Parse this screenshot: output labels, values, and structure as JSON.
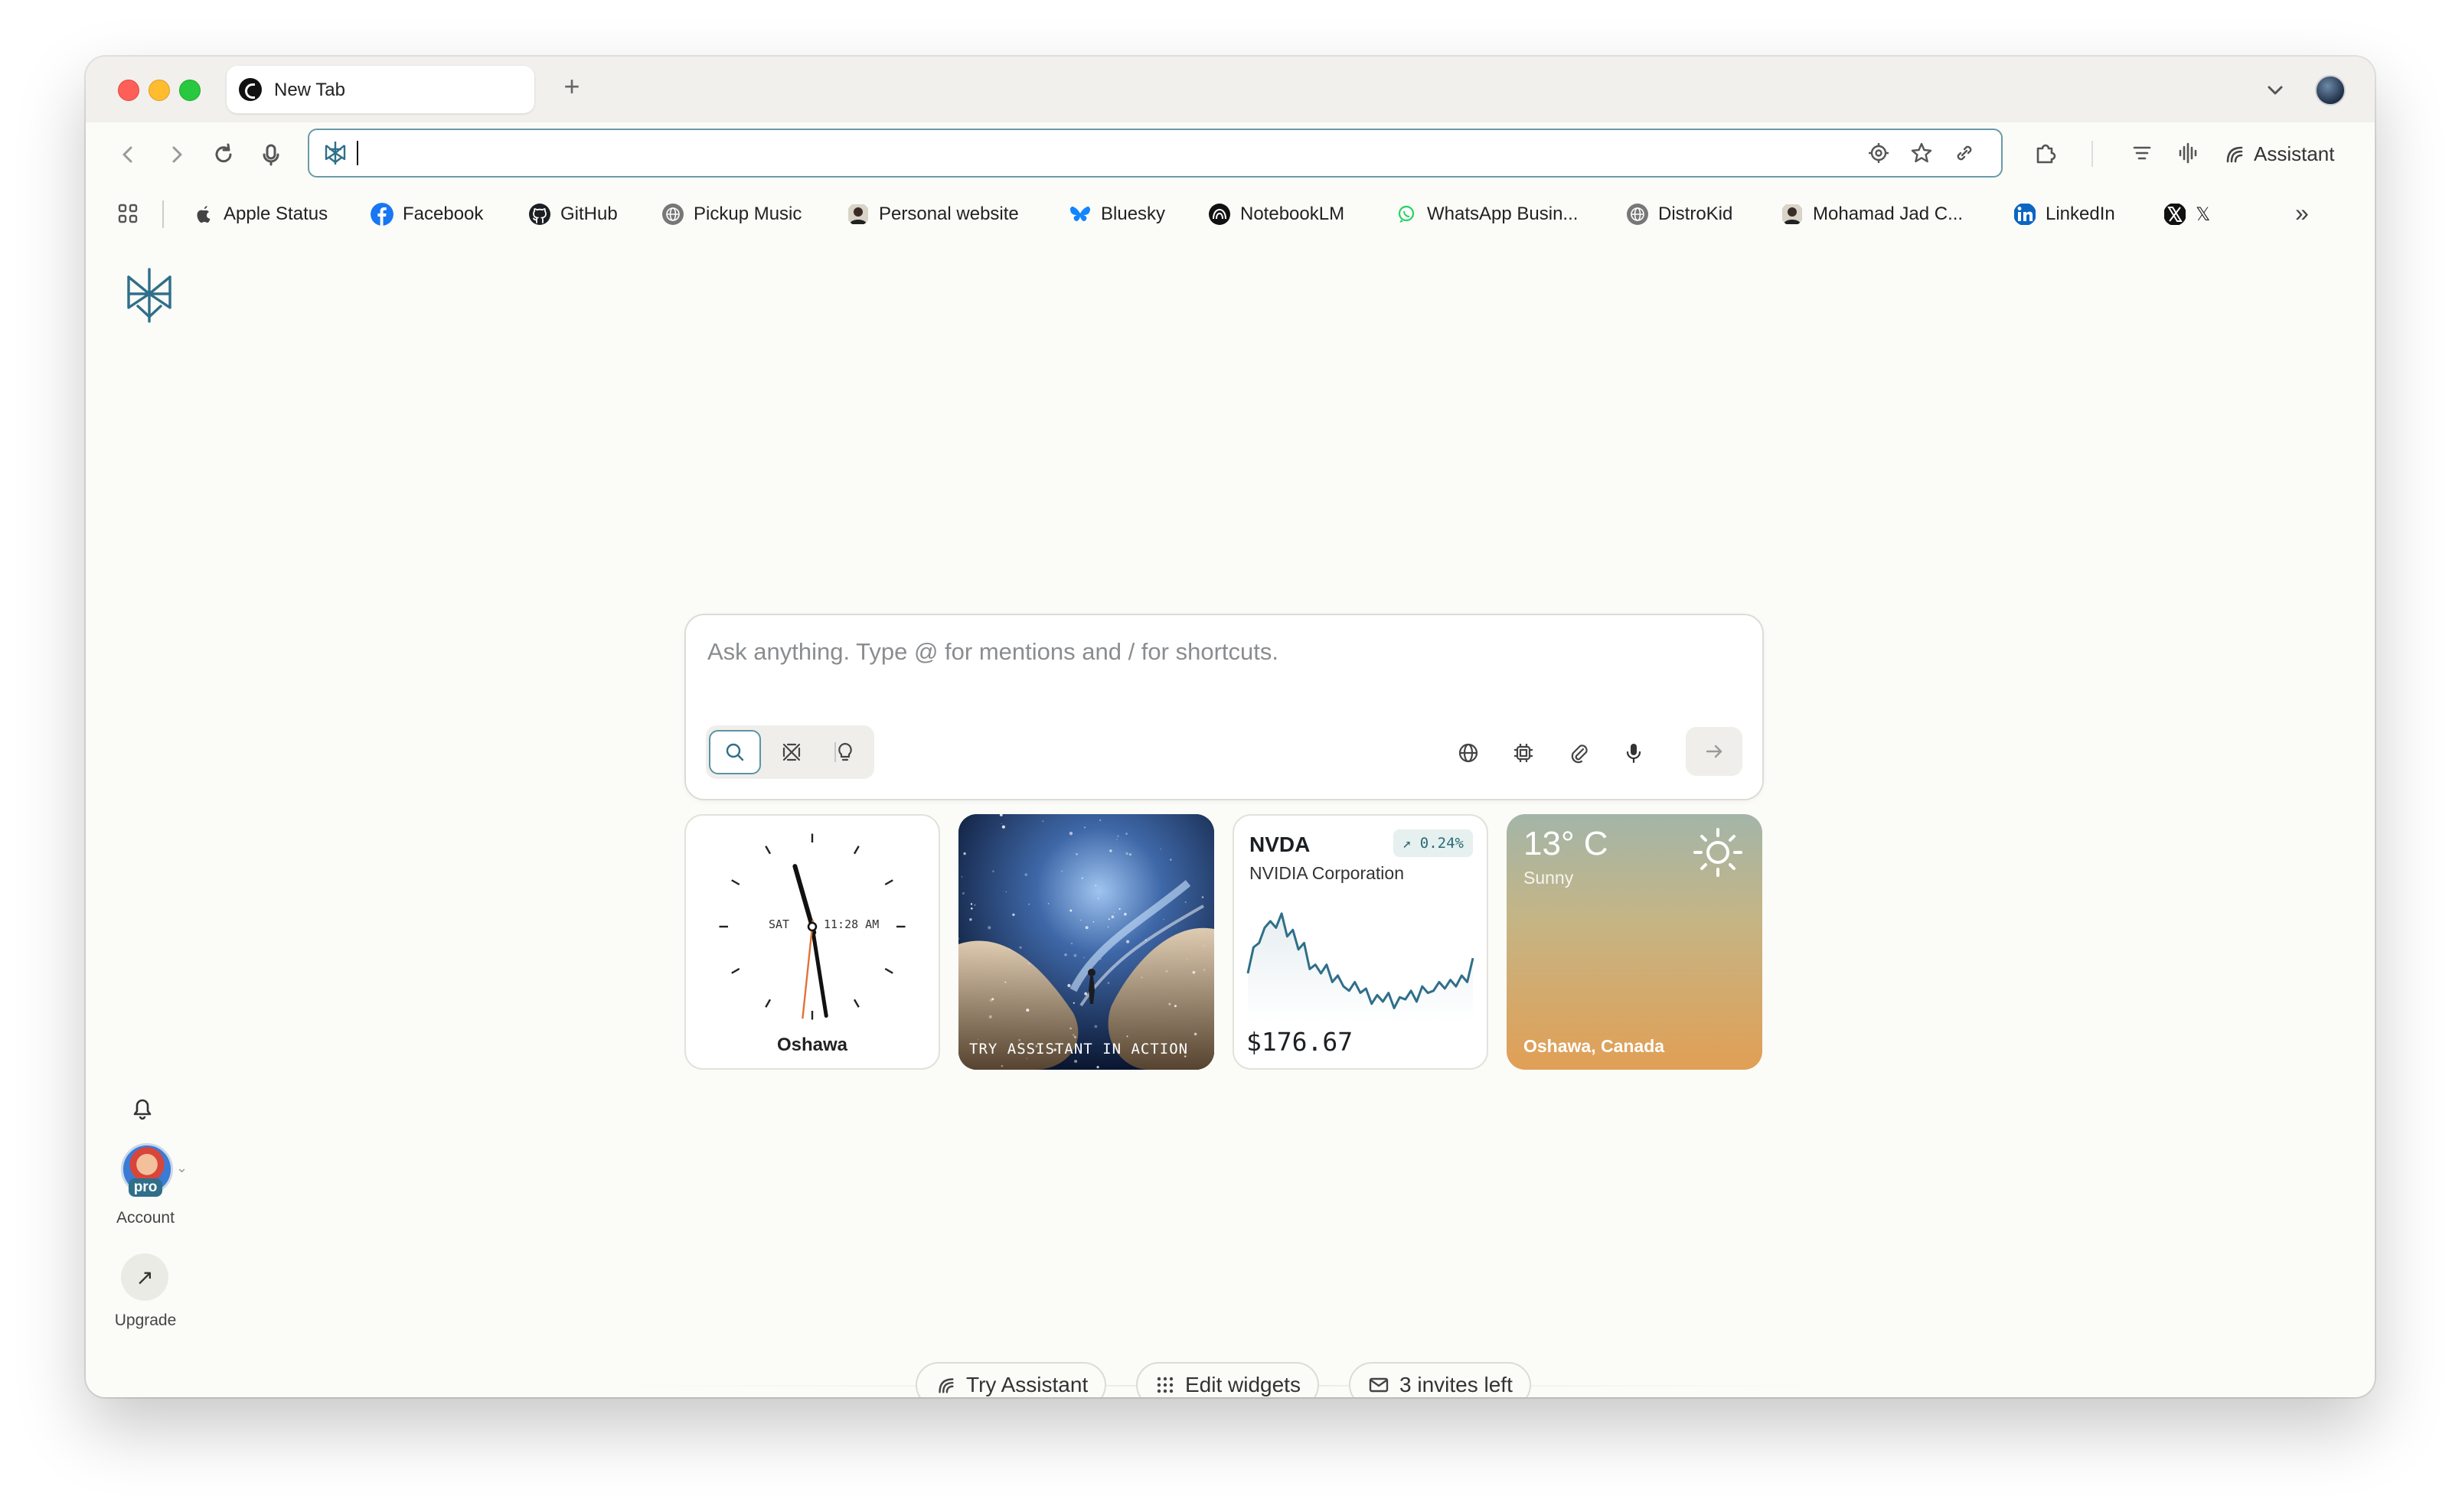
{
  "browser": {
    "tab_title": "New Tab",
    "new_tab": "+",
    "address_value": "",
    "assistant_label": "Assistant"
  },
  "bookmarks": [
    {
      "label": "Apple Status",
      "icon": "apple-icon"
    },
    {
      "label": "Facebook",
      "icon": "facebook-icon"
    },
    {
      "label": "GitHub",
      "icon": "github-icon"
    },
    {
      "label": "Pickup Music",
      "icon": "globe-icon"
    },
    {
      "label": "Personal website",
      "icon": "person-icon"
    },
    {
      "label": "Bluesky",
      "icon": "butterfly-icon"
    },
    {
      "label": "NotebookLM",
      "icon": "notebooklm-icon"
    },
    {
      "label": "WhatsApp Busin...",
      "icon": "whatsapp-icon"
    },
    {
      "label": "DistroKid",
      "icon": "globe-icon"
    },
    {
      "label": "Mohamad Jad C...",
      "icon": "person-icon"
    },
    {
      "label": "LinkedIn",
      "icon": "linkedin-icon"
    },
    {
      "label": "𝕏",
      "icon": "x-icon"
    }
  ],
  "bookmarks_more": "»",
  "sidebar": {
    "account_label": "Account",
    "pro_badge": "pro",
    "upgrade_label": "Upgrade",
    "upgrade_arrow": "↗"
  },
  "search": {
    "placeholder": "Ask anything. Type @ for mentions and / for shortcuts."
  },
  "widgets": {
    "clock": {
      "city": "Oshawa",
      "day": "SAT",
      "time": "11:28 AM",
      "hour": 11,
      "minute": 28,
      "second": 31
    },
    "image": {
      "caption": "TRY ASSISTANT IN ACTION"
    },
    "stock": {
      "symbol": "NVDA",
      "name": "NVIDIA Corporation",
      "change": "0.24%",
      "price": "$176.67",
      "trend": [
        0.38,
        0.62,
        0.66,
        0.8,
        0.86,
        0.8,
        0.93,
        0.72,
        0.78,
        0.6,
        0.66,
        0.42,
        0.46,
        0.38,
        0.46,
        0.3,
        0.36,
        0.26,
        0.22,
        0.3,
        0.2,
        0.24,
        0.1,
        0.18,
        0.12,
        0.2,
        0.06,
        0.16,
        0.14,
        0.22,
        0.12,
        0.26,
        0.2,
        0.22,
        0.3,
        0.24,
        0.32,
        0.26,
        0.36,
        0.3,
        0.52
      ]
    },
    "weather": {
      "temp": "13° C",
      "condition": "Sunny",
      "city": "Oshawa, Canada"
    }
  },
  "footer": {
    "try_assistant": "Try Assistant",
    "edit_widgets": "Edit widgets",
    "invites": "3 invites left"
  },
  "colors": {
    "accent": "#5d93a6",
    "background": "#fbfbf8",
    "stock_line": "#2f6f8a",
    "clock_second_hand": "#e0733a"
  }
}
